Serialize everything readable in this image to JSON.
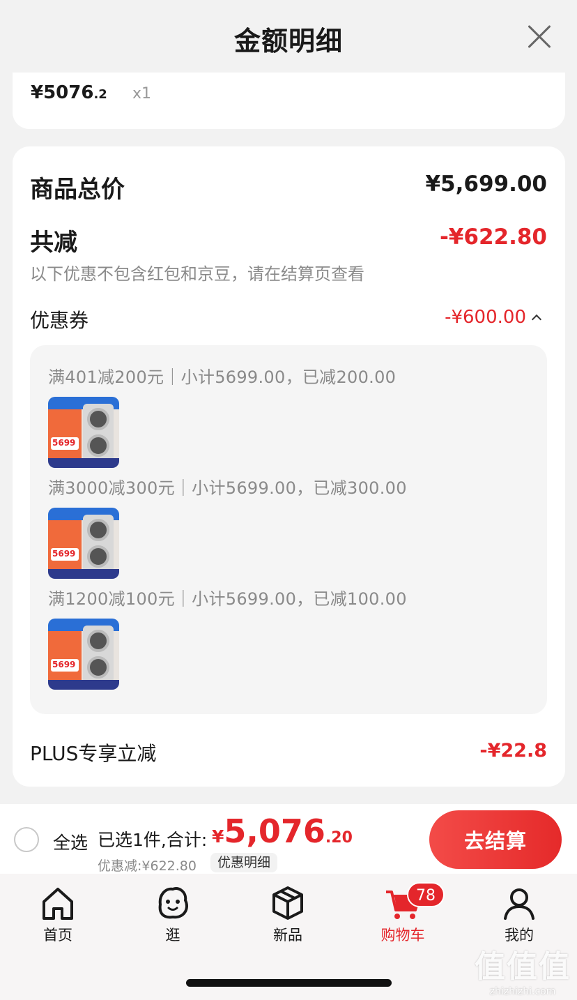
{
  "sheet": {
    "title": "金额明细"
  },
  "item": {
    "price_main": "¥5076",
    "price_decimal": ".2",
    "quantity": "x1"
  },
  "summary": {
    "goods_total_label": "商品总价",
    "goods_total_value": "¥5,699.00",
    "reduce_label": "共减",
    "reduce_value": "-¥622.80",
    "note": "以下优惠不包含红包和京豆，请在结算页查看",
    "coupon_label": "优惠券",
    "coupon_value": "-¥600.00",
    "plus_label": "PLUS专享立减",
    "plus_value": "-¥22.8"
  },
  "coupons": [
    {
      "rule": "满401减200元｜小计5699.00，已减200.00",
      "thumb_price": "5699"
    },
    {
      "rule": "满3000减300元｜小计5699.00，已减300.00",
      "thumb_price": "5699"
    },
    {
      "rule": "满1200减100元｜小计5699.00，已减100.00",
      "thumb_price": "5699"
    }
  ],
  "checkout": {
    "select_all": "全选",
    "selected_text": "已选1件,合计:",
    "total_currency": "¥",
    "total_main": "5,076",
    "total_decimal": ".20",
    "discount_text": "优惠减:¥622.80",
    "detail_link": "优惠明细",
    "button": "去结算"
  },
  "tabbar": {
    "items": [
      {
        "label": "首页",
        "icon": "home-icon"
      },
      {
        "label": "逛",
        "icon": "explore-icon"
      },
      {
        "label": "新品",
        "icon": "box-icon"
      },
      {
        "label": "购物车",
        "icon": "cart-icon"
      },
      {
        "label": "我的",
        "icon": "user-icon"
      }
    ],
    "cart_badge": "78"
  },
  "watermark": {
    "logo": "值值值",
    "site": "zhizhizhi.com"
  },
  "colors": {
    "accent_red": "#e4262b",
    "text_primary": "#1a1a1a",
    "text_secondary": "#8a8a8a"
  }
}
